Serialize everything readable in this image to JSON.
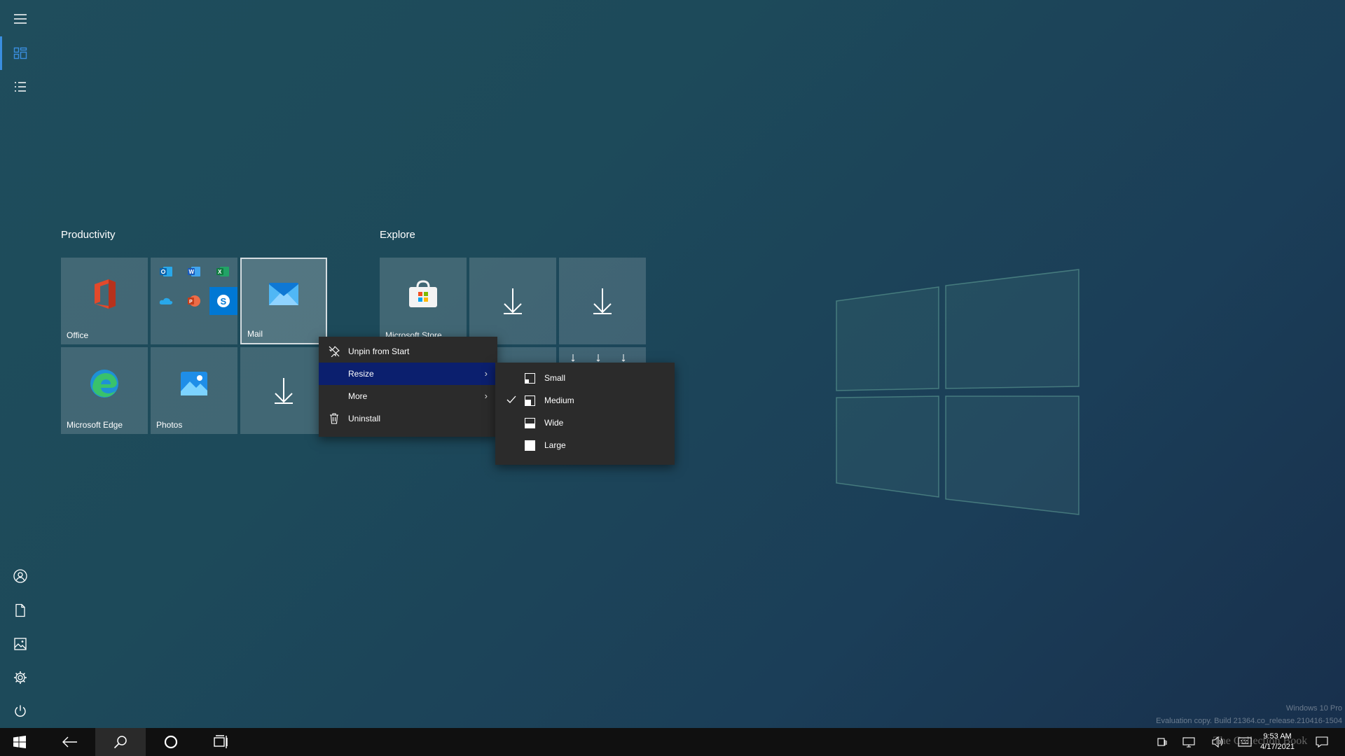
{
  "rail": {
    "items": [
      {
        "name": "menu-icon"
      },
      {
        "name": "pinned-tiles-icon"
      },
      {
        "name": "all-apps-list-icon"
      },
      {
        "name": "user-account-icon"
      },
      {
        "name": "documents-icon"
      },
      {
        "name": "pictures-icon"
      },
      {
        "name": "settings-gear-icon"
      },
      {
        "name": "power-icon"
      }
    ]
  },
  "groups": {
    "productivity": {
      "title": "Productivity"
    },
    "explore": {
      "title": "Explore"
    }
  },
  "tiles": {
    "office": "Office",
    "mail": "Mail",
    "edge": "Microsoft Edge",
    "photos": "Photos",
    "store": "Microsoft Store"
  },
  "context_menu": {
    "items": [
      {
        "label": "Unpin from Start",
        "icon": "unpin-icon"
      },
      {
        "label": "Resize",
        "icon": "",
        "submenu": true,
        "highlighted": true
      },
      {
        "label": "More",
        "icon": "",
        "submenu": true
      },
      {
        "label": "Uninstall",
        "icon": "trash-icon"
      }
    ]
  },
  "resize_menu": {
    "items": [
      {
        "label": "Small",
        "checked": false
      },
      {
        "label": "Medium",
        "checked": true
      },
      {
        "label": "Wide",
        "checked": false
      },
      {
        "label": "Large",
        "checked": false
      }
    ]
  },
  "taskbar": {
    "time": "9:53 AM",
    "date": "4/17/2021"
  },
  "watermark": {
    "line1": "Windows 10 Pro",
    "line2": "Evaluation copy. Build 21364.co_release.210416-1504",
    "brand": "The Collection Book"
  },
  "colors": {
    "accent": "#3a8ee0",
    "menu_highlight": "#0b1f6e",
    "menu_bg": "#2b2b2b",
    "taskbar_bg": "#101010"
  }
}
